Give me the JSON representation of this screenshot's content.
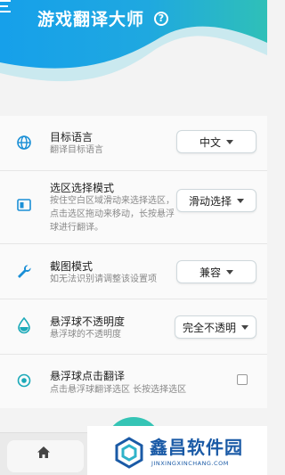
{
  "app": {
    "title": "游戏翻译大师",
    "help_glyph": "?",
    "accent_color": "#1ea1e8",
    "teal_color": "#35c4b5"
  },
  "settings": [
    {
      "id": "target-language",
      "icon": "globe-icon",
      "title": "目标语言",
      "desc": "翻译目标语言",
      "control": "select",
      "value": "中文"
    },
    {
      "id": "selection-mode",
      "icon": "selection-area-icon",
      "title": "选区选择模式",
      "desc": "按住空白区域滑动来选择选区，点击选区拖动来移动，长按悬浮球进行翻译。",
      "control": "select",
      "value": "滑动选择"
    },
    {
      "id": "screenshot-mode",
      "icon": "wrench-icon",
      "title": "截图模式",
      "desc": "如无法识别请调整该设置项",
      "control": "select",
      "value": "兼容"
    },
    {
      "id": "ball-opacity",
      "icon": "droplet-icon",
      "title": "悬浮球不透明度",
      "desc": "悬浮球的不透明度",
      "control": "select",
      "value": "完全不透明"
    },
    {
      "id": "ball-click-translate",
      "icon": "target-icon",
      "title": "悬浮球点击翻译",
      "desc": "点击悬浮球翻译选区 长按选择选区",
      "control": "checkbox",
      "checked": false
    }
  ],
  "bottom_nav": {
    "home_icon": "home-icon"
  },
  "watermark": {
    "title": "鑫昌软件园",
    "subtitle": "JINXINGXINCHANG.COM"
  }
}
